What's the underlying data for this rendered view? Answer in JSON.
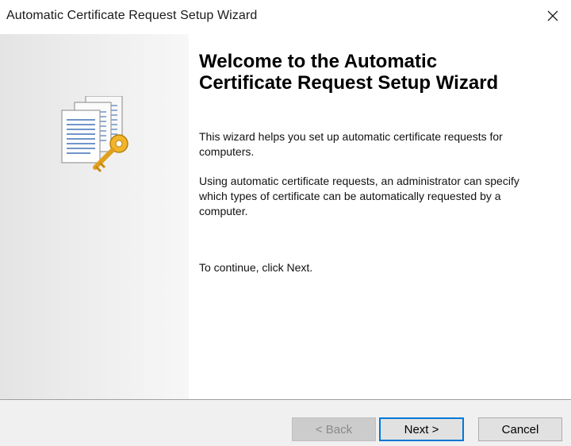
{
  "window": {
    "title": "Automatic Certificate Request Setup Wizard"
  },
  "content": {
    "heading": "Welcome to the Automatic Certificate Request Setup Wizard",
    "paragraph1": "This wizard helps you set up automatic certificate requests for computers.",
    "paragraph2": "Using automatic certificate requests, an administrator can specify which types of certificate can be automatically requested by a computer.",
    "paragraph3": "To continue, click Next."
  },
  "buttons": {
    "back_label": "< Back",
    "next_label": "Next >",
    "cancel_label": "Cancel"
  },
  "icons": {
    "close": "close-icon",
    "wizard": "certificate-key-icon"
  },
  "colors": {
    "focus_border": "#0078d7",
    "disabled_text": "#8a8a8a",
    "footer_bg": "#f0f0f0"
  }
}
